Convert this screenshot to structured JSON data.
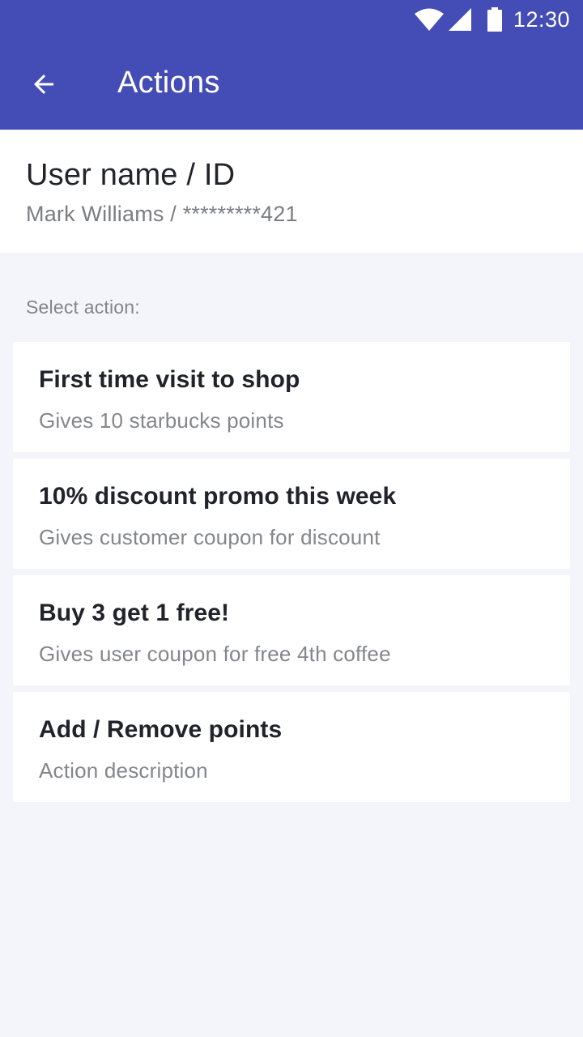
{
  "status_bar": {
    "time": "12:30",
    "icons": [
      "wifi-icon",
      "signal-icon",
      "battery-icon"
    ]
  },
  "toolbar": {
    "back_icon": "arrow-left-icon",
    "title": "Actions"
  },
  "user": {
    "title": "User name / ID",
    "value": "Mark Williams / *********421"
  },
  "section_label": "Select action:",
  "actions": [
    {
      "title": "First time visit to shop",
      "description": "Gives 10 starbucks points"
    },
    {
      "title": "10% discount promo this week",
      "description": "Gives customer coupon for discount"
    },
    {
      "title": "Buy 3 get 1 free!",
      "description": "Gives user coupon for free 4th coffee"
    },
    {
      "title": "Add / Remove points",
      "description": "Action description"
    }
  ],
  "colors": {
    "primary": "#434db5",
    "background": "#f4f5fb",
    "card": "#ffffff",
    "title_text": "#22232a",
    "secondary_text": "#85868d"
  }
}
